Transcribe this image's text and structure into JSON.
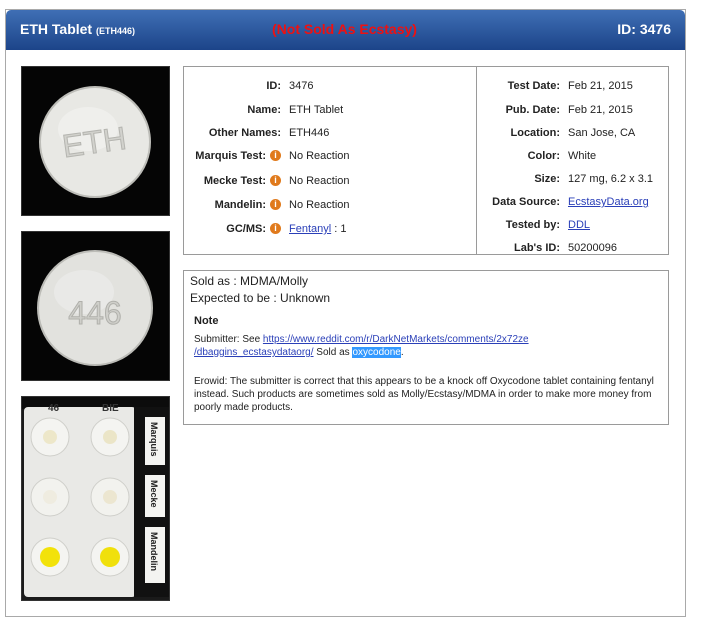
{
  "header": {
    "title": "ETH Tablet",
    "title_code": "(ETH446)",
    "warning": "(Not Sold As Ecstasy)",
    "id_text": "ID: 3476"
  },
  "photos": [
    {
      "name": "tablet-front-photo",
      "imprint": "ETH"
    },
    {
      "name": "tablet-back-photo",
      "imprint": "446"
    },
    {
      "name": "reagent-test-photo",
      "plate_labels": [
        "46",
        "BIE"
      ],
      "reagent_labels": [
        "Marquis",
        "Mecke",
        "Mandelin"
      ]
    }
  ],
  "info_left": [
    {
      "label": "ID:",
      "value": "3476",
      "icon": false
    },
    {
      "label": "Name:",
      "value": "ETH Tablet",
      "icon": false
    },
    {
      "label": "Other Names:",
      "value": "ETH446",
      "icon": false
    },
    {
      "label": "Marquis Test:",
      "value": "No Reaction",
      "icon": true
    },
    {
      "label": "Mecke Test:",
      "value": "No Reaction",
      "icon": true
    },
    {
      "label": "Mandelin:",
      "value": "No Reaction",
      "icon": true
    },
    {
      "label": "GC/MS:",
      "value_link": "Fentanyl",
      "value_suffix": " : 1",
      "icon": true
    }
  ],
  "info_right": [
    {
      "label": "Test Date:",
      "value": "Feb 21, 2015"
    },
    {
      "label": "Pub. Date:",
      "value": "Feb 21, 2015"
    },
    {
      "label": "Location:",
      "value": "San Jose, CA"
    },
    {
      "label": "Color:",
      "value": "White"
    },
    {
      "label": "Size:",
      "value": "127 mg, 6.2 x 3.1"
    },
    {
      "label": "Data Source:",
      "value_link": "EcstasyData.org"
    },
    {
      "label": "Tested by:",
      "value_link": "DDL"
    },
    {
      "label": "Lab's ID:",
      "value": "50200096"
    }
  ],
  "notes": {
    "sold_as": "Sold as : MDMA/Molly",
    "expected": "Expected to be : Unknown",
    "note_title": "Note",
    "submitter_prefix": "Submitter: See ",
    "submitter_link_1": "https://www.reddit.com/r/DarkNetMarkets/comments/2x72ze",
    "submitter_link_2": "/dbaggins_ecstasydataorg/",
    "submitter_mid": " Sold as ",
    "submitter_highlight": "oxycodone",
    "submitter_end": ".",
    "erowid": "Erowid: The submitter is correct that this appears to be a knock off Oxycodone tablet containing fentanyl instead. Such products are sometimes sold as Molly/Ecstasy/MDMA in order to make more money from poorly made products."
  },
  "colors": {
    "header_blue": "#1c4489",
    "warning_red": "#ee1111",
    "info_orange": "#e07a1c",
    "link_blue": "#2a3fb8",
    "highlight": "#3399ff"
  }
}
